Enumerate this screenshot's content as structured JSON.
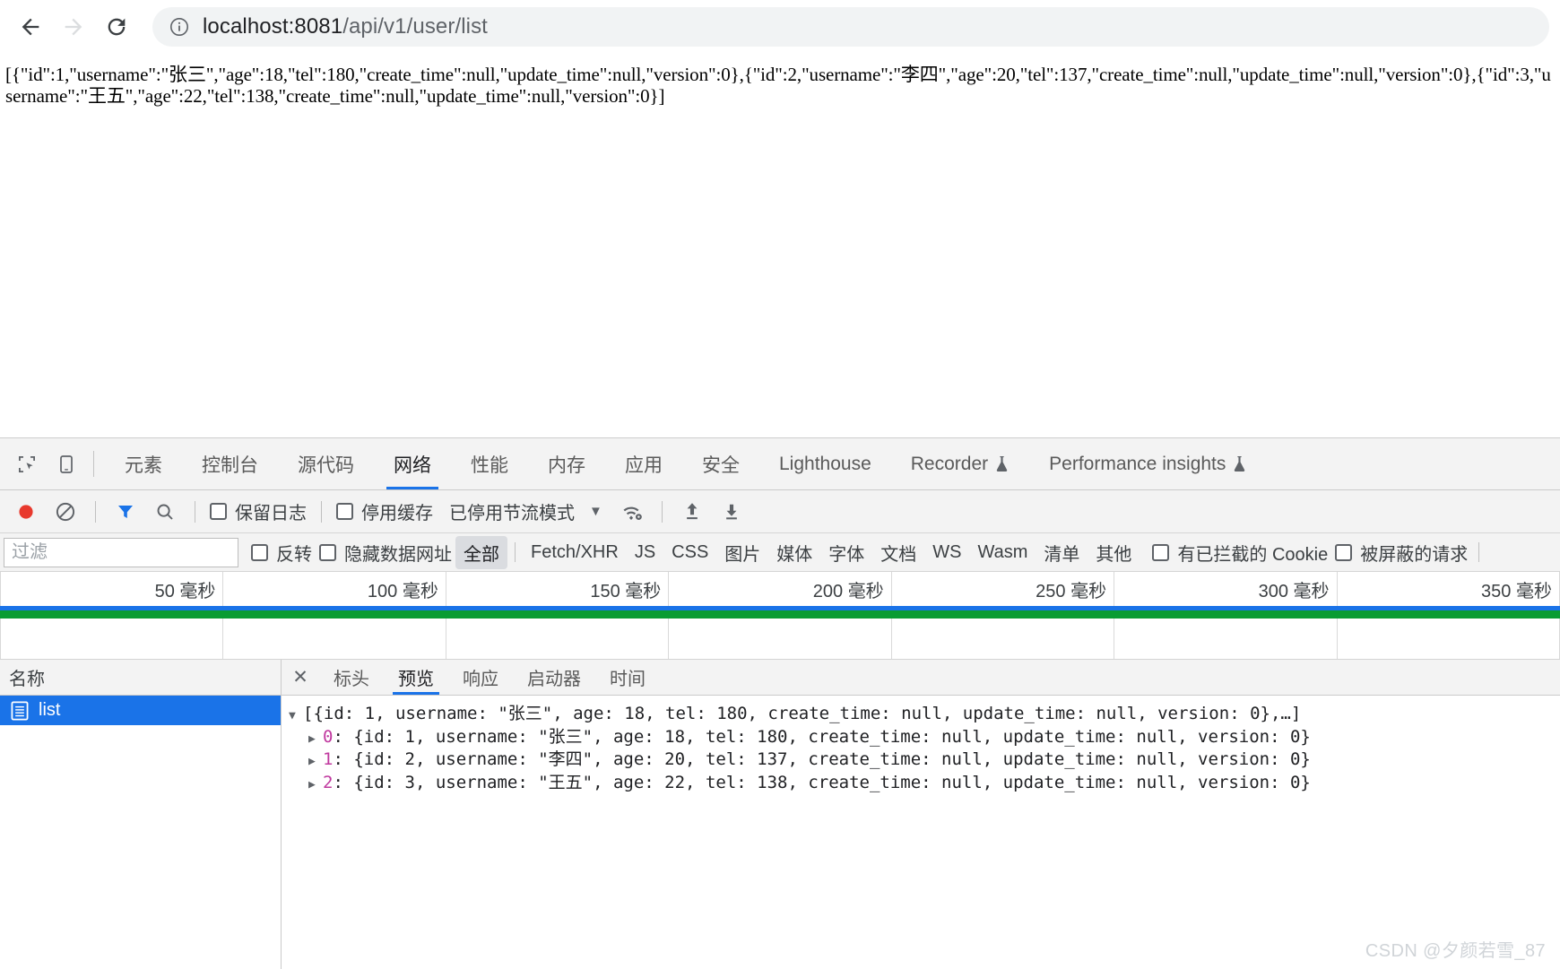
{
  "browser": {
    "back_label": "back",
    "forward_label": "forward",
    "reload_label": "reload",
    "url_host": "localhost:8081",
    "url_path": "/api/v1/user/list",
    "url_full": "localhost:8081/api/v1/user/list"
  },
  "page": {
    "raw_json": "[{\"id\":1,\"username\":\"张三\",\"age\":18,\"tel\":180,\"create_time\":null,\"update_time\":null,\"version\":0},{\"id\":2,\"username\":\"李四\",\"age\":20,\"tel\":137,\"create_time\":null,\"update_time\":null,\"version\":0},{\"id\":3,\"username\":\"王五\",\"age\":22,\"tel\":138,\"create_time\":null,\"update_time\":null,\"version\":0}]"
  },
  "devtools": {
    "tabs": [
      {
        "label": "元素",
        "active": false,
        "beaker": false
      },
      {
        "label": "控制台",
        "active": false,
        "beaker": false
      },
      {
        "label": "源代码",
        "active": false,
        "beaker": false
      },
      {
        "label": "网络",
        "active": true,
        "beaker": false
      },
      {
        "label": "性能",
        "active": false,
        "beaker": false
      },
      {
        "label": "内存",
        "active": false,
        "beaker": false
      },
      {
        "label": "应用",
        "active": false,
        "beaker": false
      },
      {
        "label": "安全",
        "active": false,
        "beaker": false
      },
      {
        "label": "Lighthouse",
        "active": false,
        "beaker": false
      },
      {
        "label": "Recorder",
        "active": false,
        "beaker": true
      },
      {
        "label": "Performance insights",
        "active": false,
        "beaker": true
      }
    ],
    "toolbar": {
      "record_label": "录制",
      "clear_label": "清除",
      "filter_label": "过滤器",
      "search_label": "搜索",
      "preserve_log_label": "保留日志",
      "disable_cache_label": "停用缓存",
      "throttle_label": "已停用节流模式",
      "throttle_caret": "▼",
      "network_conditions_label": "网络状况",
      "import_label": "导入 HAR",
      "export_label": "导出 HAR"
    },
    "filterbar": {
      "filter_placeholder": "过滤",
      "filter_value": "",
      "invert_label": "反转",
      "hide_data_urls_label": "隐藏数据网址",
      "types": [
        {
          "label": "全部",
          "selected": true
        },
        {
          "label": "Fetch/XHR",
          "selected": false
        },
        {
          "label": "JS",
          "selected": false
        },
        {
          "label": "CSS",
          "selected": false
        },
        {
          "label": "图片",
          "selected": false
        },
        {
          "label": "媒体",
          "selected": false
        },
        {
          "label": "字体",
          "selected": false
        },
        {
          "label": "文档",
          "selected": false
        },
        {
          "label": "WS",
          "selected": false
        },
        {
          "label": "Wasm",
          "selected": false
        },
        {
          "label": "清单",
          "selected": false
        },
        {
          "label": "其他",
          "selected": false
        }
      ],
      "blocked_cookies_label": "有已拦截的 Cookie",
      "blocked_requests_label": "被屏蔽的请求"
    },
    "overview": {
      "ticks": [
        "50 毫秒",
        "100 毫秒",
        "150 毫秒",
        "200 毫秒",
        "250 毫秒",
        "300 毫秒",
        "350 毫秒"
      ],
      "bar_color_primary": "#1a73e8",
      "bar_color_secondary": "#0a9c33"
    },
    "requests": {
      "column_header": "名称",
      "rows": [
        {
          "name": "list",
          "selected": true,
          "icon": "document-icon"
        }
      ]
    },
    "detail": {
      "close_label": "✕",
      "tabs": [
        {
          "label": "标头",
          "active": false
        },
        {
          "label": "预览",
          "active": true
        },
        {
          "label": "响应",
          "active": false
        },
        {
          "label": "启动器",
          "active": false
        },
        {
          "label": "时间",
          "active": false
        }
      ],
      "preview": {
        "root_line": "[{id: 1, username: \"张三\", age: 18, tel: 180, create_time: null, update_time: null, version: 0},…]",
        "root_triangle": "▼",
        "children": [
          {
            "triangle": "▶",
            "index": "0",
            "text": ": {id: 1, username: \"张三\", age: 18, tel: 180, create_time: null, update_time: null, version: 0}"
          },
          {
            "triangle": "▶",
            "index": "1",
            "text": ": {id: 2, username: \"李四\", age: 20, tel: 137, create_time: null, update_time: null, version: 0}"
          },
          {
            "triangle": "▶",
            "index": "2",
            "text": ": {id: 3, username: \"王五\", age: 22, tel: 138, create_time: null, update_time: null, version: 0}"
          }
        ]
      }
    }
  },
  "watermark": "CSDN @夕颜若雪_87"
}
